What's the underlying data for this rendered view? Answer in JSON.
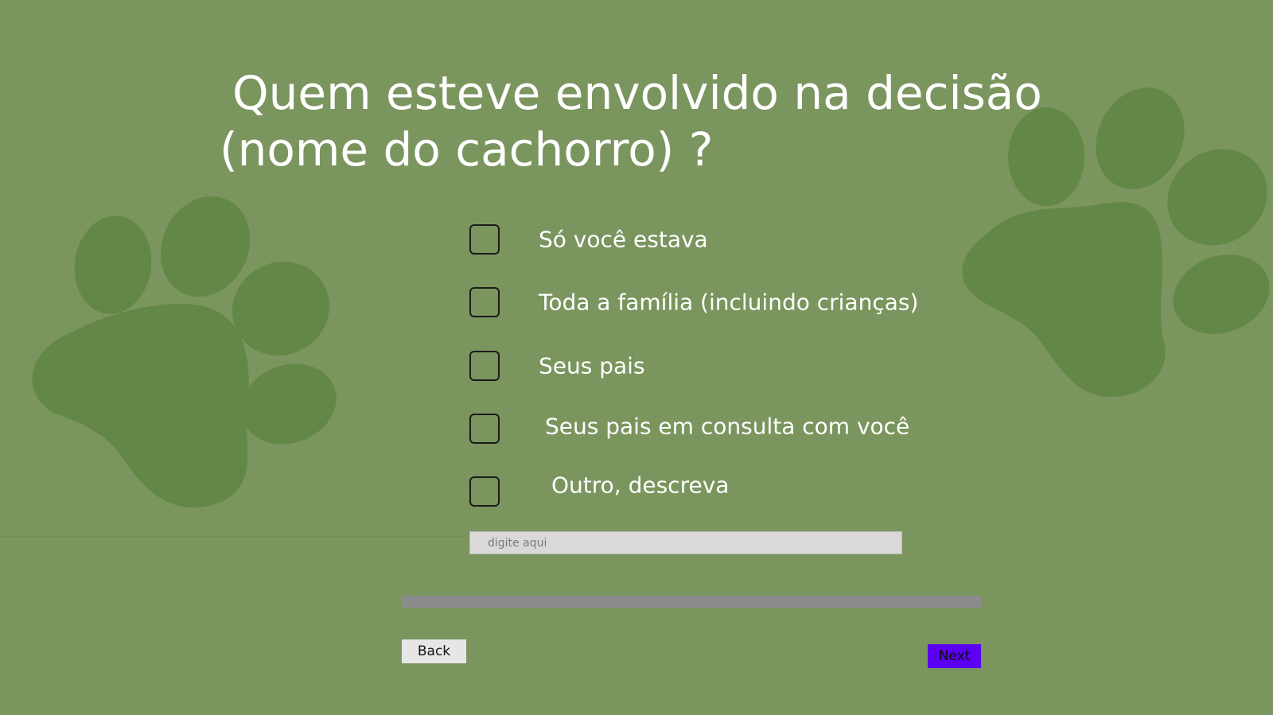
{
  "question": {
    "line1": "Quem esteve envolvido na decisão",
    "line2": "(nome do cachorro) ?"
  },
  "options": [
    {
      "label": "Só você estava",
      "checked": false
    },
    {
      "label": "Toda a família (incluindo crianças)",
      "checked": false
    },
    {
      "label": "Seus pais",
      "checked": false
    },
    {
      "label": "Seus pais em consulta com você",
      "checked": false
    },
    {
      "label": "Outro, descreva",
      "checked": false
    }
  ],
  "other_input": {
    "placeholder": "digite aqui",
    "value": ""
  },
  "navigation": {
    "back_label": "Back",
    "next_label": "Next"
  },
  "icons": [
    "paw-print-icon"
  ],
  "colors": {
    "background": "#7b955e",
    "paw": "#638747",
    "next_button": "#5b00f2",
    "back_button": "#e6e6e6",
    "progress_bar": "#8c8c8c",
    "input_background": "#d9d9d9"
  }
}
